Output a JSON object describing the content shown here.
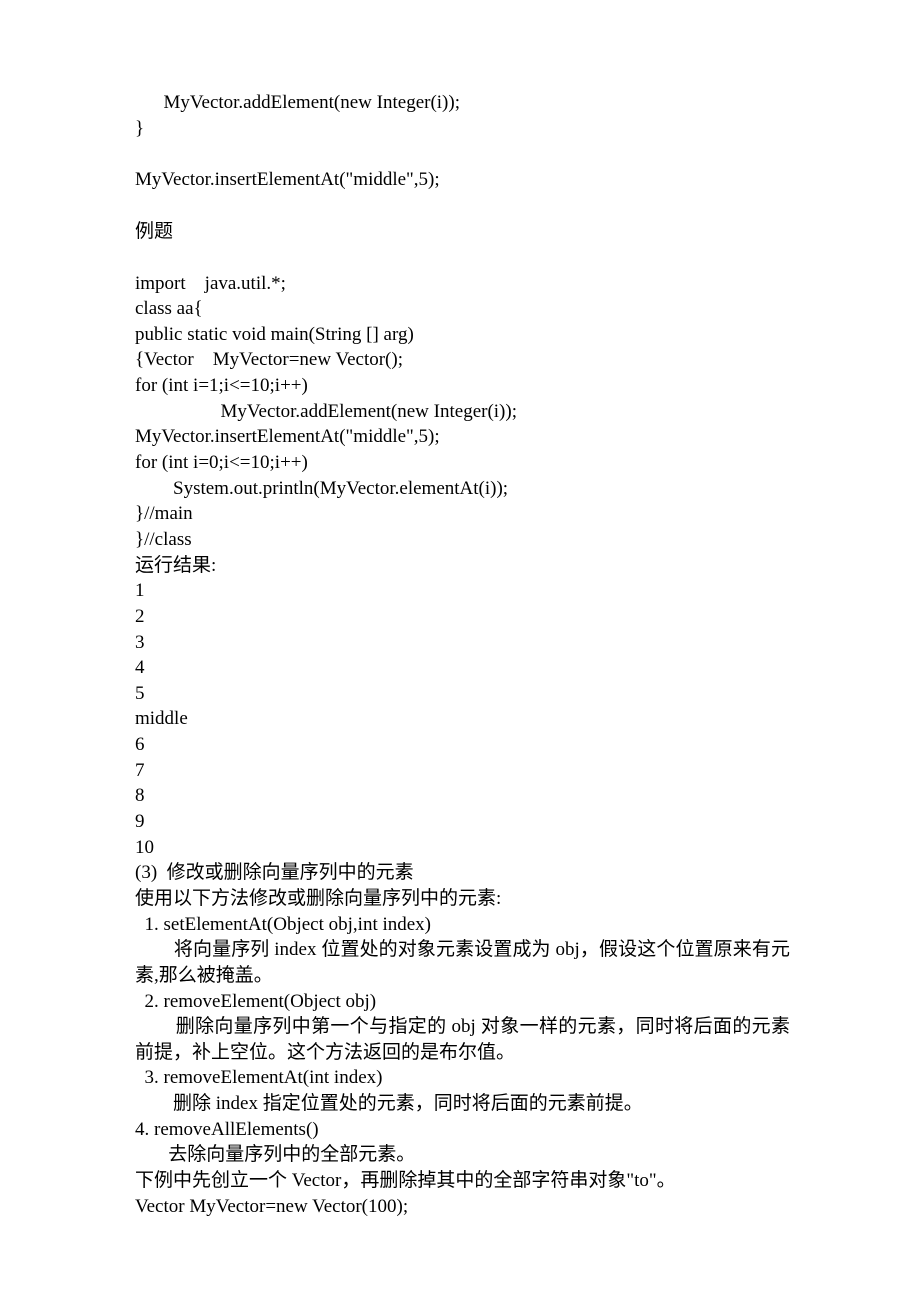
{
  "lines": {
    "l01": "      MyVector.addElement(new Integer(i));",
    "l02": "}",
    "l03": "MyVector.insertElementAt(\"middle\",5);",
    "l04": "例题",
    "l05": "import    java.util.*;",
    "l06": "class aa{",
    "l07": "public static void main(String [] arg)",
    "l08": "{Vector    MyVector=new Vector();",
    "l09": "for (int i=1;i<=10;i++)",
    "l10": "                  MyVector.addElement(new Integer(i));",
    "l11": "MyVector.insertElementAt(\"middle\",5);",
    "l12": "for (int i=0;i<=10;i++)",
    "l13": "        System.out.println(MyVector.elementAt(i));",
    "l14": "}//main",
    "l15": "}//class",
    "l16": "运行结果:",
    "l17": "1",
    "l18": "2",
    "l19": "3",
    "l20": "4",
    "l21": "5",
    "l22": "middle",
    "l23": "6",
    "l24": "7",
    "l25": "8",
    "l26": "9",
    "l27": "10",
    "l28": "(3)  修改或删除向量序列中的元素",
    "l29": "使用以下方法修改或删除向量序列中的元素:",
    "l30": "  1. setElementAt(Object obj,int index)",
    "l31": "        将向量序列 index 位置处的对象元素设置成为 obj，假设这个位置原来有元素,那么被掩盖。",
    "l32": "  2. removeElement(Object obj)",
    "l33": "        删除向量序列中第一个与指定的 obj 对象一样的元素，同时将后面的元素前提，补上空位。这个方法返回的是布尔值。",
    "l34": "  3. removeElementAt(int index)",
    "l35": "        删除 index 指定位置处的元素，同时将后面的元素前提。",
    "l36": "4. removeAllElements()",
    "l37": "       去除向量序列中的全部元素。",
    "l38": "下例中先创立一个 Vector，再删除掉其中的全部字符串对象\"to\"。",
    "l39": "Vector MyVector=new Vector(100);"
  }
}
